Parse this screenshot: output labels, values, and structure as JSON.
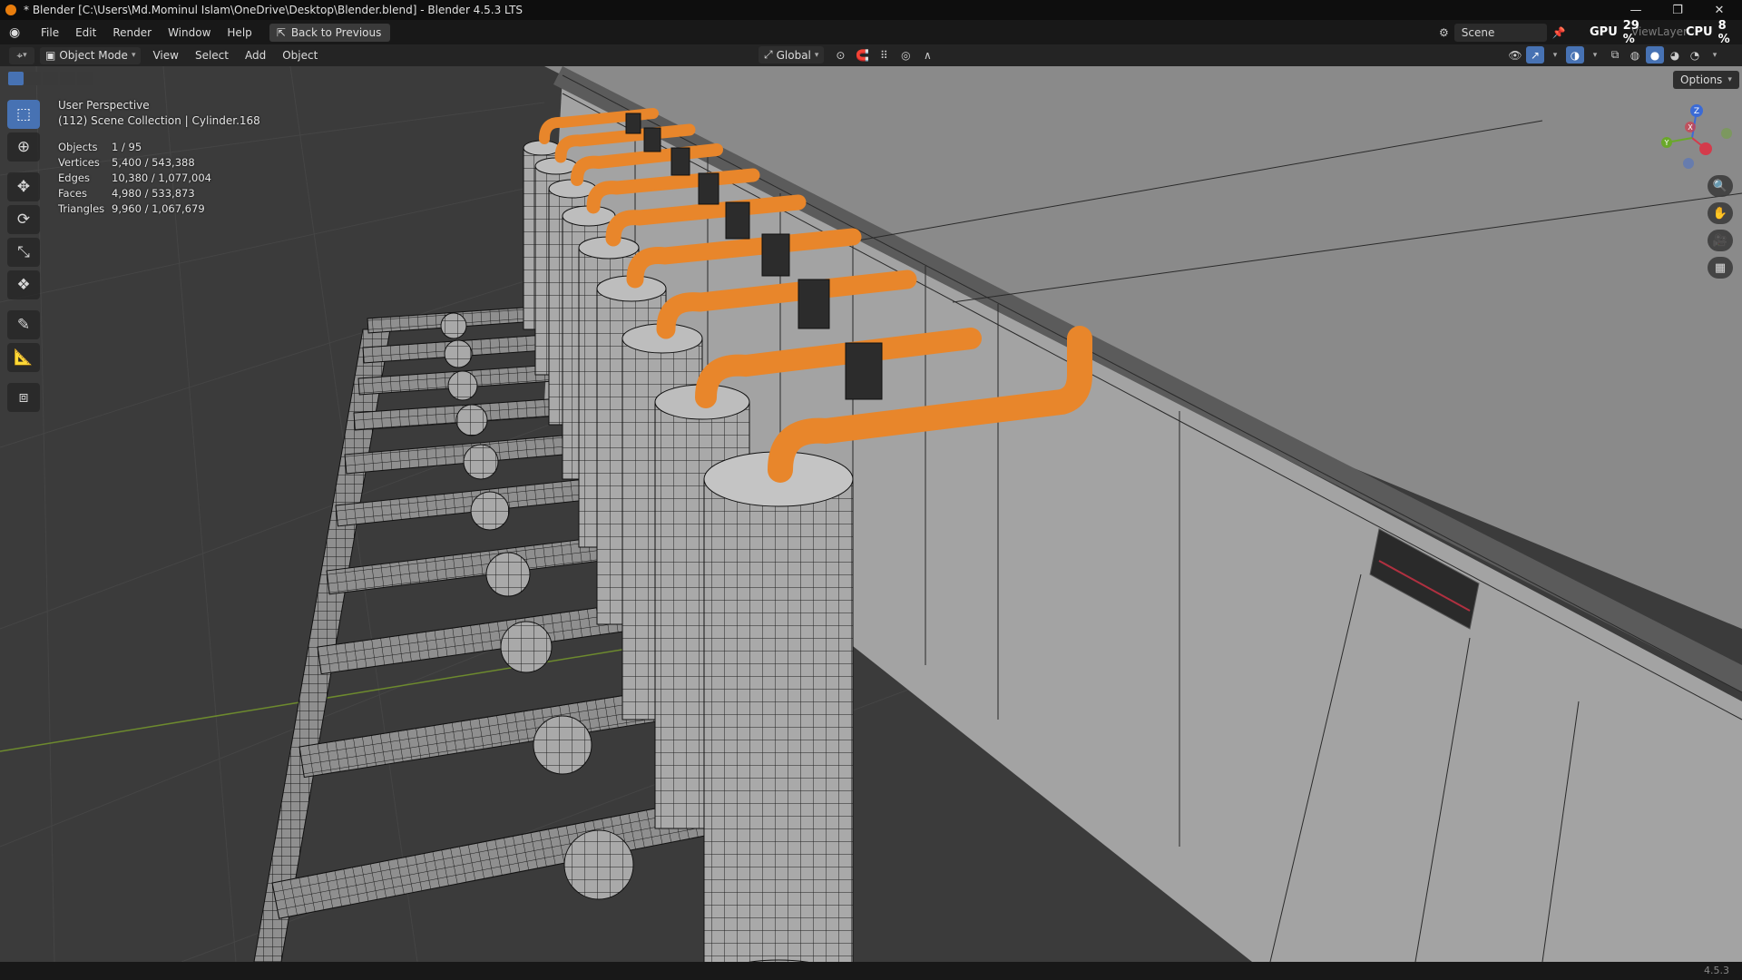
{
  "window": {
    "title": "* Blender [C:\\Users\\Md.Mominul Islam\\OneDrive\\Desktop\\Blender.blend] - Blender 4.5.3 LTS",
    "minimize_icon": "minimize-icon",
    "maximize_icon": "restore-icon",
    "close_icon": "close-icon"
  },
  "menubar": {
    "items": [
      "File",
      "Edit",
      "Render",
      "Window",
      "Help"
    ],
    "back_button": "Back to Previous",
    "scene_label": "Scene",
    "viewlayer_label": "ViewLayer",
    "gpu_label": "GPU",
    "gpu_value": "29 %",
    "cpu_label": "CPU",
    "cpu_value": "8 %"
  },
  "header": {
    "mode": "Object Mode",
    "menus": [
      "View",
      "Select",
      "Add",
      "Object"
    ],
    "transform_orientation": "Global",
    "options_label": "Options"
  },
  "viewport": {
    "perspective": "User Perspective",
    "collection_line": "(112) Scene Collection | Cylinder.168",
    "stats": [
      {
        "label": "Objects",
        "value": "1 / 95"
      },
      {
        "label": "Vertices",
        "value": "5,400 / 543,388"
      },
      {
        "label": "Edges",
        "value": "10,380 / 1,077,004"
      },
      {
        "label": "Faces",
        "value": "4,980 / 533,873"
      },
      {
        "label": "Triangles",
        "value": "9,960 / 1,067,679"
      }
    ],
    "gizmo_axes": {
      "x": "X",
      "y": "Y",
      "z": "Z"
    },
    "selection_color": "#e8862b",
    "wire_color": "#1a1a1a"
  },
  "toolbar": {
    "tools": [
      "select-box-icon",
      "cursor-icon",
      "move-icon",
      "rotate-icon",
      "scale-icon",
      "transform-icon",
      "annotate-icon",
      "measure-icon",
      "add-cube-icon"
    ]
  },
  "statusbar": {
    "version": "4.5.3"
  }
}
